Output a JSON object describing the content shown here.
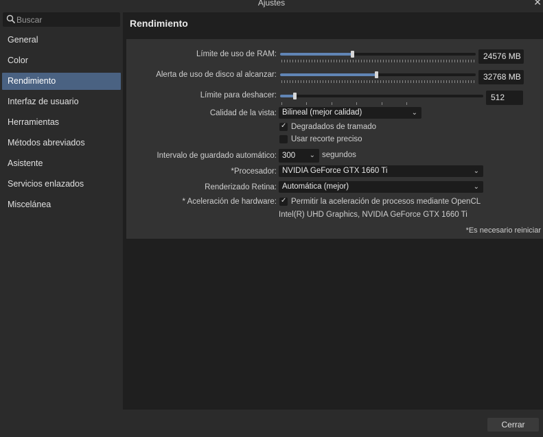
{
  "window": {
    "title": "Ajustes",
    "close_glyph": "✕"
  },
  "search": {
    "placeholder": "Buscar"
  },
  "sidebar": {
    "items": [
      {
        "label": "General"
      },
      {
        "label": "Color"
      },
      {
        "label": "Rendimiento",
        "active": true
      },
      {
        "label": "Interfaz de usuario"
      },
      {
        "label": "Herramientas"
      },
      {
        "label": "Métodos abreviados"
      },
      {
        "label": "Asistente"
      },
      {
        "label": "Servicios enlazados"
      },
      {
        "label": "Miscelánea"
      }
    ]
  },
  "main": {
    "heading": "Rendimiento",
    "ram": {
      "label": "Límite de uso de RAM:",
      "value": "24576 MB",
      "fraction": 0.37
    },
    "disk": {
      "label": "Alerta de uso de disco al alcanzar:",
      "value": "32768 MB",
      "fraction": 0.49
    },
    "undo": {
      "label": "Límite para deshacer:",
      "value": "512",
      "fraction": 0.07
    },
    "view_quality": {
      "label": "Calidad de la vista:",
      "value": "Bilineal (mejor calidad)"
    },
    "dither": {
      "label": "Degradados de tramado",
      "checked": true
    },
    "precise_clip": {
      "label": "Usar recorte preciso",
      "checked": false
    },
    "autosave": {
      "label": "Intervalo de guardado automático:",
      "value": "300",
      "unit": "segundos"
    },
    "processor": {
      "label": "*Procesador:",
      "value": "NVIDIA GeForce GTX 1660 Ti"
    },
    "retina": {
      "label": "Renderizado Retina:",
      "value": "Automática (mejor)"
    },
    "hw_accel": {
      "label": "* Aceleración de hardware:",
      "checkbox_label": "Permitir la aceleración de procesos mediante OpenCL",
      "checked": true,
      "devices": "Intel(R) UHD Graphics, NVIDIA GeForce GTX 1660 Ti"
    },
    "restart_note": "*Es necesario reiniciar"
  },
  "footer": {
    "close_label": "Cerrar"
  },
  "colors": {
    "accent": "#6185b5",
    "selected": "#4a6282",
    "background": "#2b2b2b"
  }
}
